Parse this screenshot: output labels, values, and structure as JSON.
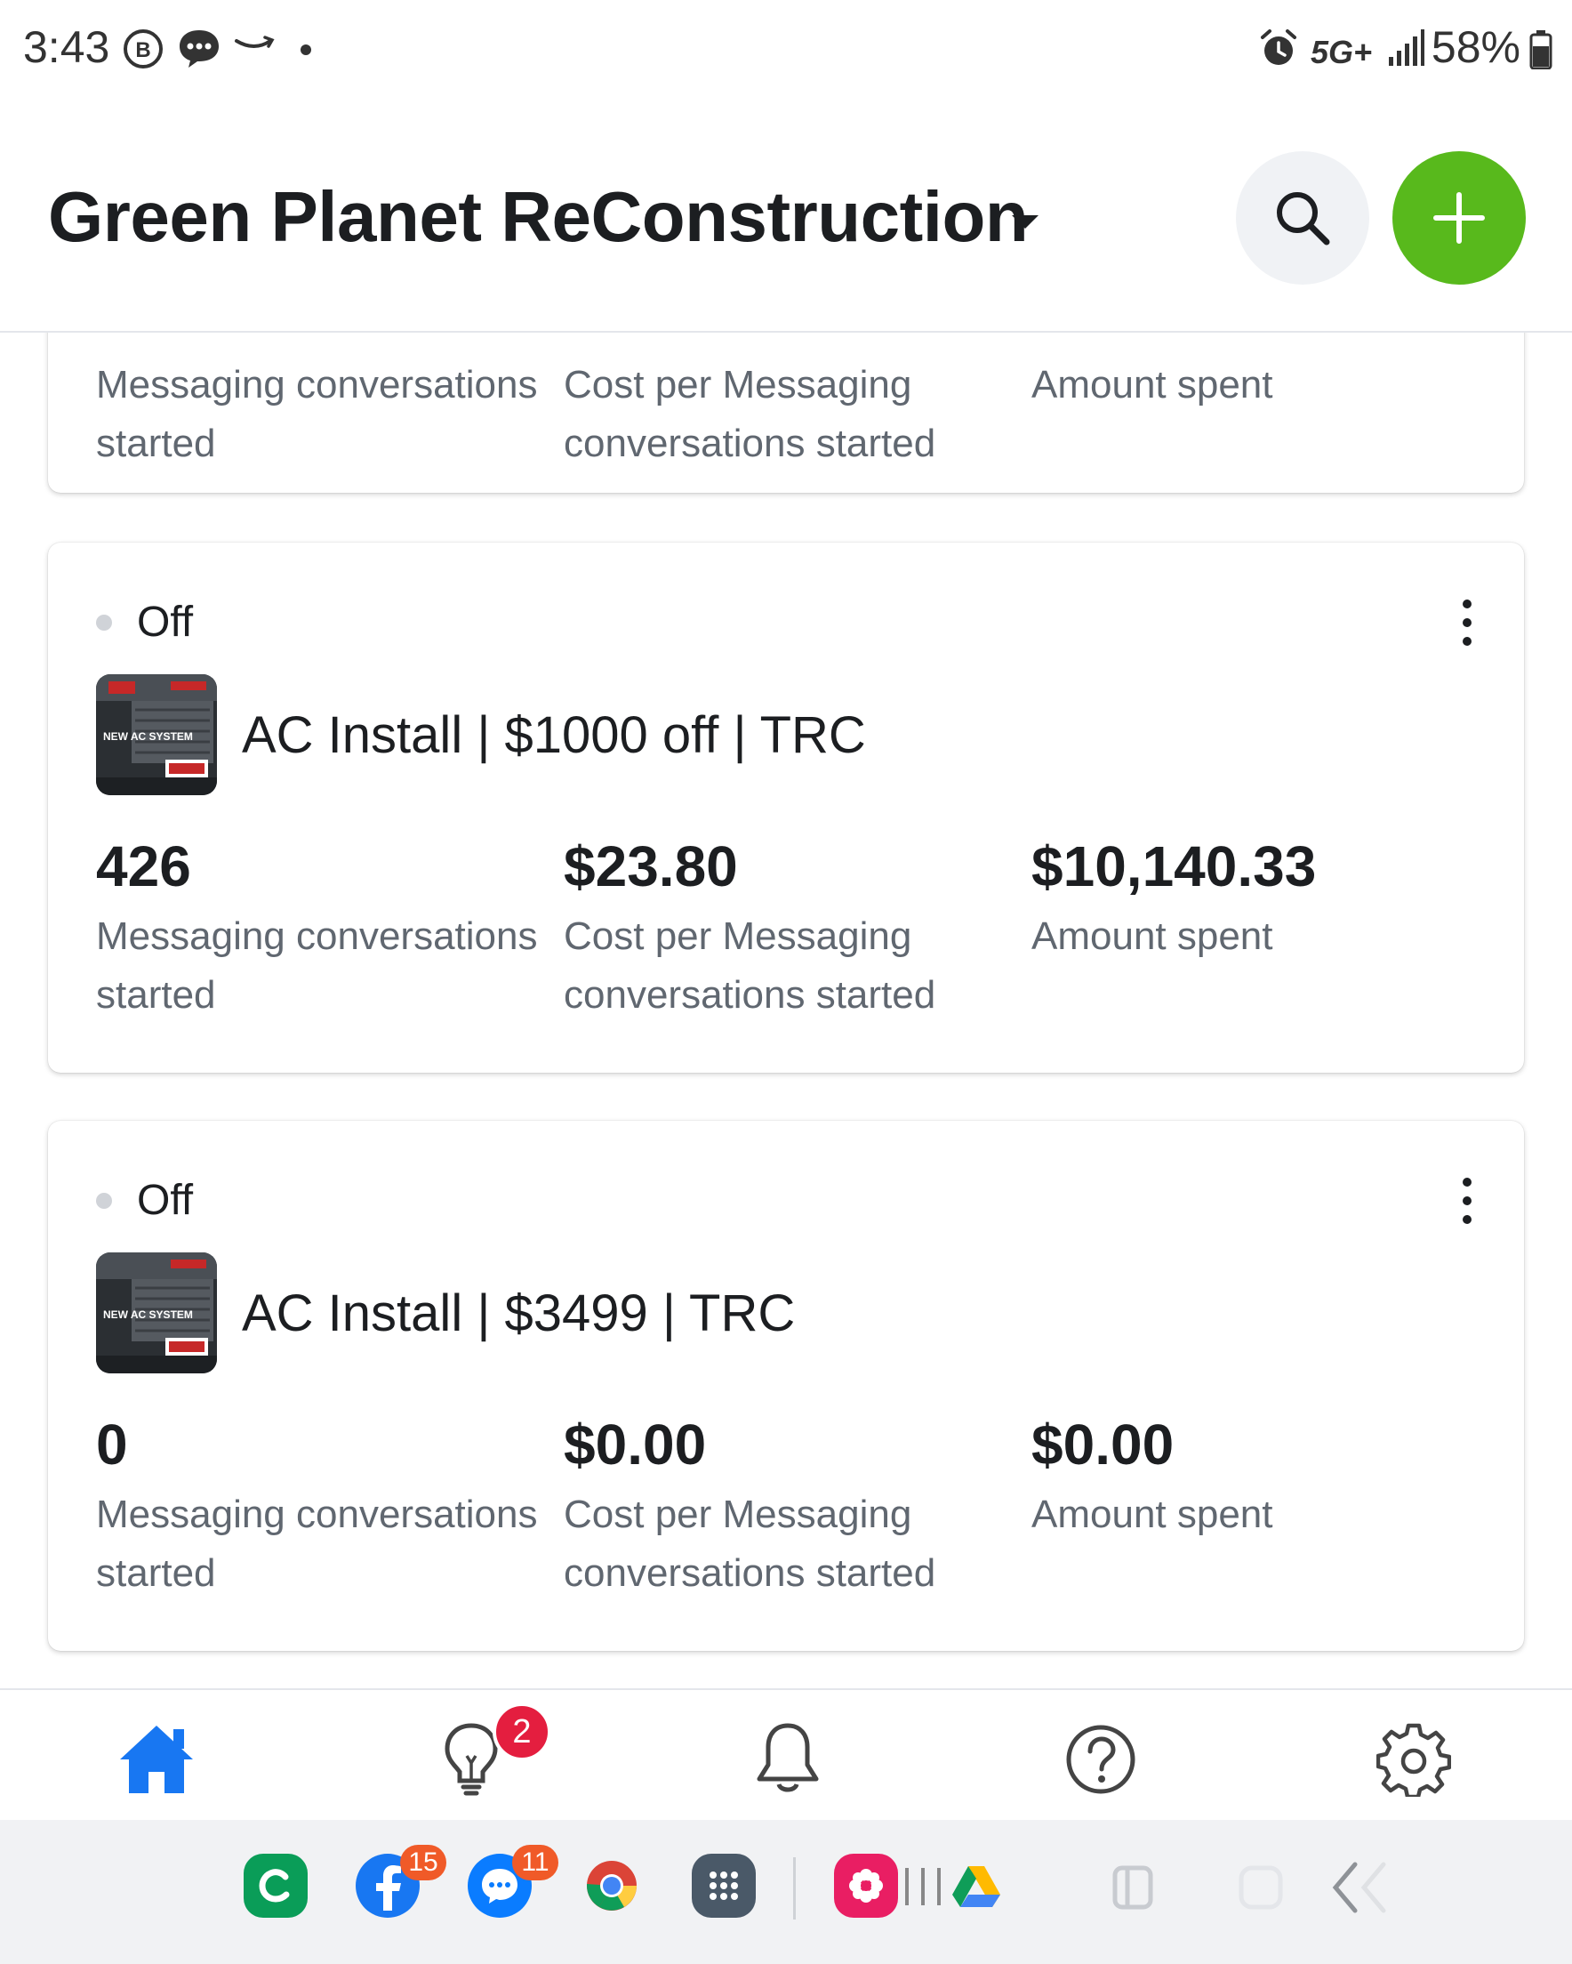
{
  "status_bar": {
    "time": "3:43",
    "network": "5G+",
    "battery_text": "58%",
    "icons": [
      "bixby-icon",
      "messages-icon",
      "amazon-icon",
      "dot-icon",
      "alarm-icon",
      "signal-icon",
      "battery-icon"
    ]
  },
  "header": {
    "title": "Green Planet ReConstruction",
    "icons": [
      "caret-down-icon",
      "search-icon",
      "plus-icon"
    ],
    "accent_color": "#58b91c"
  },
  "cards": [
    {
      "metrics": [
        {
          "value": "",
          "label": "Messaging conversations started"
        },
        {
          "value": "",
          "label": "Cost per Messaging conversations started"
        },
        {
          "value": "",
          "label": "Amount spent"
        }
      ]
    },
    {
      "status": "Off",
      "ad_name": "AC Install | $1000 off | TRC",
      "thumbnail_text": "NEW AC SYSTEM",
      "metrics": [
        {
          "value": "426",
          "label": "Messaging conversations started"
        },
        {
          "value": "$23.80",
          "label": "Cost per Messaging conversations started"
        },
        {
          "value": "$10,140.33",
          "label": "Amount spent"
        }
      ]
    },
    {
      "status": "Off",
      "ad_name": "AC Install | $3499 | TRC",
      "thumbnail_text": "NEW AC SYSTEM",
      "metrics": [
        {
          "value": "0",
          "label": "Messaging conversations started"
        },
        {
          "value": "$0.00",
          "label": "Cost per Messaging conversations started"
        },
        {
          "value": "$0.00",
          "label": "Amount spent"
        }
      ]
    }
  ],
  "bottom_nav": {
    "items": [
      "home-icon",
      "lightbulb-icon",
      "bell-icon",
      "help-icon",
      "settings-icon"
    ],
    "active": "home-icon",
    "active_color": "#1877f2",
    "insights_badge": "2"
  },
  "dock": {
    "apps": [
      "c-app-icon",
      "facebook-icon",
      "messenger-icon",
      "chrome-icon",
      "app-drawer-icon",
      "gallery-icon",
      "drive-icon"
    ],
    "facebook_badge": "15",
    "messenger_badge": "11",
    "nav": [
      "recents-icon",
      "home-button-icon",
      "back-icon"
    ]
  }
}
